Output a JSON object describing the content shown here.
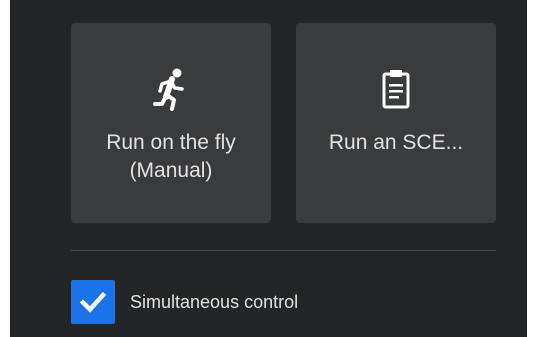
{
  "tiles": {
    "manual": {
      "label": "Run on the fly\n(Manual)",
      "icon": "running-person-icon"
    },
    "scene": {
      "label": "Run an SCE...",
      "icon": "clipboard-icon"
    }
  },
  "options": {
    "simultaneous_control": {
      "label": "Simultaneous control",
      "checked": true
    }
  },
  "colors": {
    "background": "#242526",
    "tile": "#3a3b3d",
    "text": "#e2e2e2",
    "accent": "#1a73e8"
  }
}
